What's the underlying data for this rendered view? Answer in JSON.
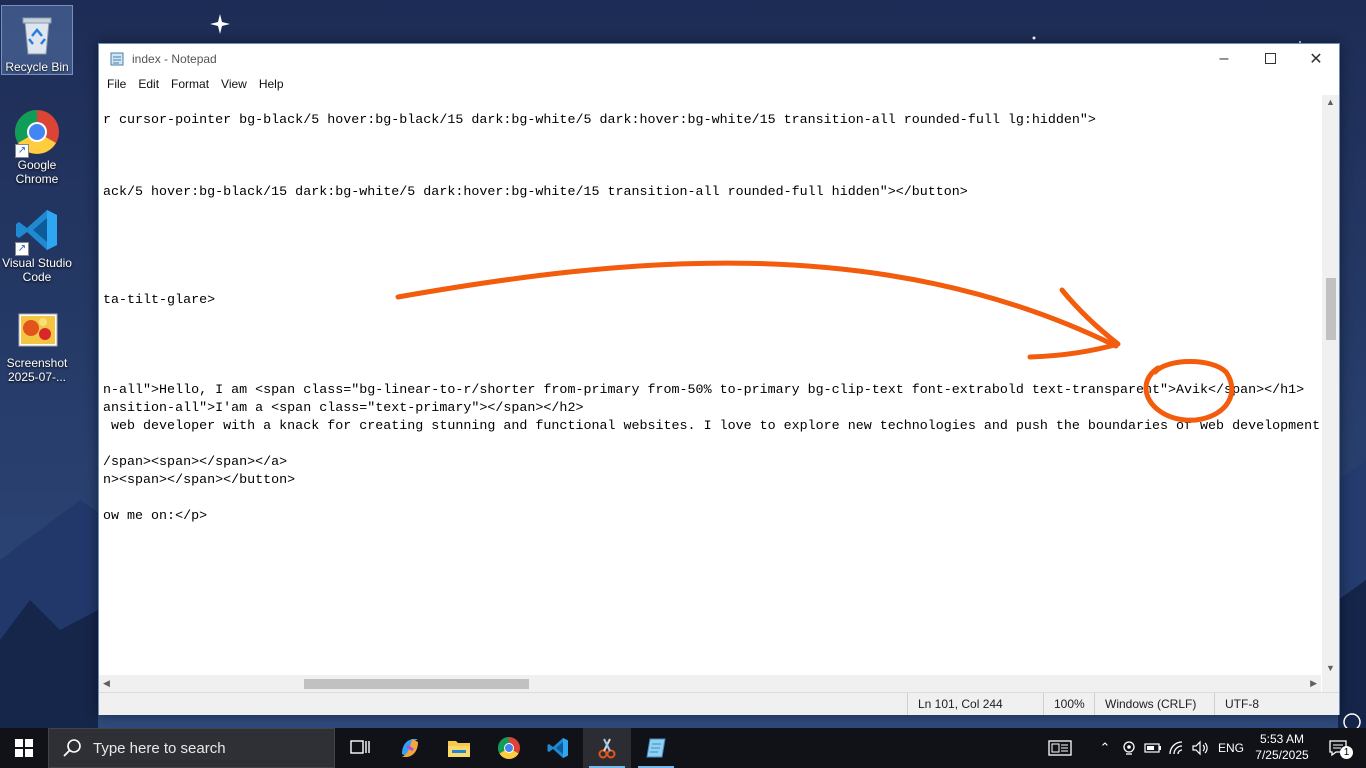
{
  "desktop": {
    "icons": [
      {
        "label": "Recycle Bin"
      },
      {
        "label": "Google Chrome"
      },
      {
        "label": "Visual Studio Code"
      },
      {
        "label": "Screenshot 2025-07-..."
      }
    ]
  },
  "window": {
    "title": "index - Notepad",
    "menu": [
      "File",
      "Edit",
      "Format",
      "View",
      "Help"
    ],
    "lines": [
      "r cursor-pointer bg-black/5 hover:bg-black/15 dark:bg-white/5 dark:hover:bg-white/15 transition-all rounded-full lg:hidden\">",
      "ack/5 hover:bg-black/15 dark:bg-white/5 dark:hover:bg-white/15 transition-all rounded-full hidden\"></button>",
      "ta-tilt-glare>",
      "n-all\">Hello, I am <span class=\"bg-linear-to-r/shorter from-primary from-50% to-primary bg-clip-text font-extrabold text-transparent\">Avik</span></h1>",
      "ansition-all\">I'am a <span class=\"text-primary\"></span></h2>",
      " web developer with a knack for creating stunning and functional websites. I love to explore new technologies and push the boundaries of web development",
      "/span><span></span></a>",
      "n><span></span></button>",
      "ow me on:</p>"
    ],
    "status": {
      "position": "Ln 101, Col 244",
      "zoom": "100%",
      "line_ending": "Windows (CRLF)",
      "encoding": "UTF-8"
    }
  },
  "taskbar": {
    "search_placeholder": "Type here to search",
    "language": "ENG",
    "time": "5:53 AM",
    "date": "7/25/2025",
    "notification_count": "1"
  }
}
